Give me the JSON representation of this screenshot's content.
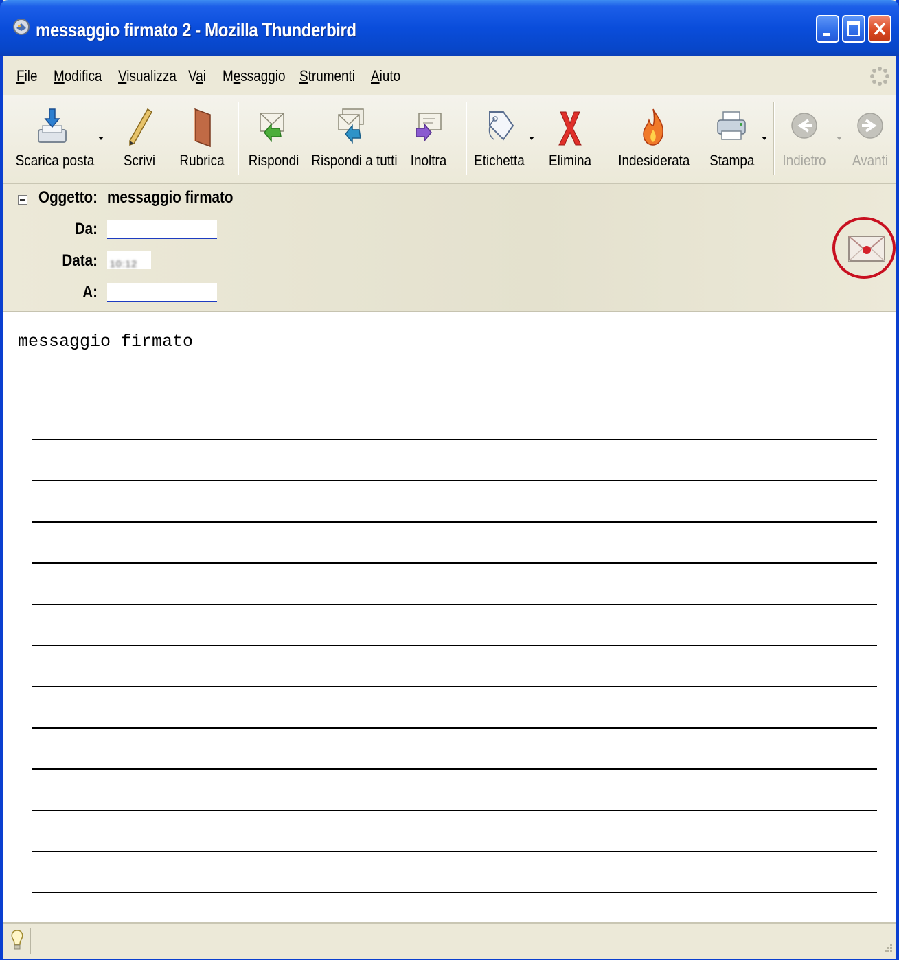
{
  "window": {
    "title": "messaggio firmato 2 - Mozilla Thunderbird",
    "app_icon": "thunderbird-icon",
    "title_color": "#0a4ddb"
  },
  "menu": {
    "items": [
      {
        "label": "File",
        "underline": "F"
      },
      {
        "label": "Modifica",
        "underline": "M"
      },
      {
        "label": "Visualizza",
        "underline": "V"
      },
      {
        "label": "Vai",
        "underline": "a"
      },
      {
        "label": "Messaggio",
        "underline": "e"
      },
      {
        "label": "Strumenti",
        "underline": "S"
      },
      {
        "label": "Aiuto",
        "underline": "A"
      }
    ]
  },
  "toolbar": {
    "buttons": [
      {
        "label": "Scarica posta",
        "icon": "get-mail-icon",
        "dropdown": true,
        "enabled": true
      },
      {
        "label": "Scrivi",
        "icon": "pencil-icon",
        "dropdown": false,
        "enabled": true
      },
      {
        "label": "Rubrica",
        "icon": "address-book-icon",
        "dropdown": false,
        "enabled": true
      },
      {
        "label": "Rispondi",
        "icon": "reply-icon",
        "dropdown": false,
        "enabled": true
      },
      {
        "label": "Rispondi a tutti",
        "icon": "reply-all-icon",
        "dropdown": false,
        "enabled": true
      },
      {
        "label": "Inoltra",
        "icon": "forward-icon",
        "dropdown": false,
        "enabled": true
      },
      {
        "label": "Etichetta",
        "icon": "tag-icon",
        "dropdown": true,
        "enabled": true
      },
      {
        "label": "Elimina",
        "icon": "delete-icon",
        "dropdown": false,
        "enabled": true
      },
      {
        "label": "Indesiderata",
        "icon": "junk-flame-icon",
        "dropdown": false,
        "enabled": true
      },
      {
        "label": "Stampa",
        "icon": "print-icon",
        "dropdown": true,
        "enabled": true
      },
      {
        "label": "Indietro",
        "icon": "back-arrow-icon",
        "dropdown": true,
        "enabled": false
      },
      {
        "label": "Avanti",
        "icon": "forward-arrow-icon",
        "dropdown": false,
        "enabled": false
      }
    ]
  },
  "header": {
    "subject_label": "Oggetto:",
    "subject_value": "messaggio firmato",
    "from_label": "Da:",
    "date_label": "Data:",
    "date_value": "10:12",
    "to_label": "A:",
    "signature_icon": "signed-envelope-icon",
    "highlight_color": "#c81020"
  },
  "body": {
    "text": "messaggio firmato"
  },
  "statusbar": {
    "icon": "lightbulb-icon"
  }
}
